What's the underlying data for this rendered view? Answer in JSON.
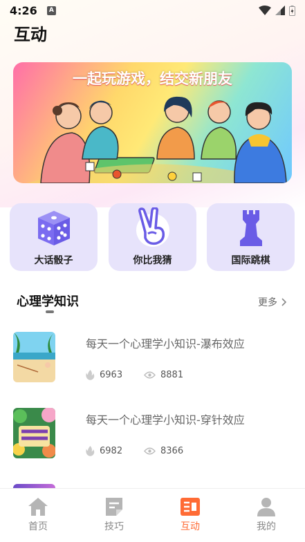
{
  "status": {
    "time": "4:26",
    "icon_a": "A"
  },
  "header": {
    "title": "互动"
  },
  "banner": {
    "title": "一起玩游戏，结交新朋友"
  },
  "games": [
    {
      "label": "大话骰子",
      "icon": "dice-icon"
    },
    {
      "label": "你比我猜",
      "icon": "victory-hand-icon"
    },
    {
      "label": "国际跳棋",
      "icon": "chess-rook-icon"
    }
  ],
  "section": {
    "title": "心理学知识",
    "more": "更多"
  },
  "articles": [
    {
      "title": "每天一个心理学小知识-瀑布效应",
      "hot": "6963",
      "views": "8881"
    },
    {
      "title": "每天一个心理学小知识-穿针效应",
      "hot": "6982",
      "views": "8366"
    }
  ],
  "tabs": [
    {
      "label": "首页",
      "icon": "home-icon"
    },
    {
      "label": "技巧",
      "icon": "tips-icon"
    },
    {
      "label": "互动",
      "icon": "interact-icon"
    },
    {
      "label": "我的",
      "icon": "profile-icon"
    }
  ],
  "colors": {
    "accent": "#ff6b35",
    "card_bg": "#e7e3fb",
    "icon_purple": "#7b6cf0"
  }
}
